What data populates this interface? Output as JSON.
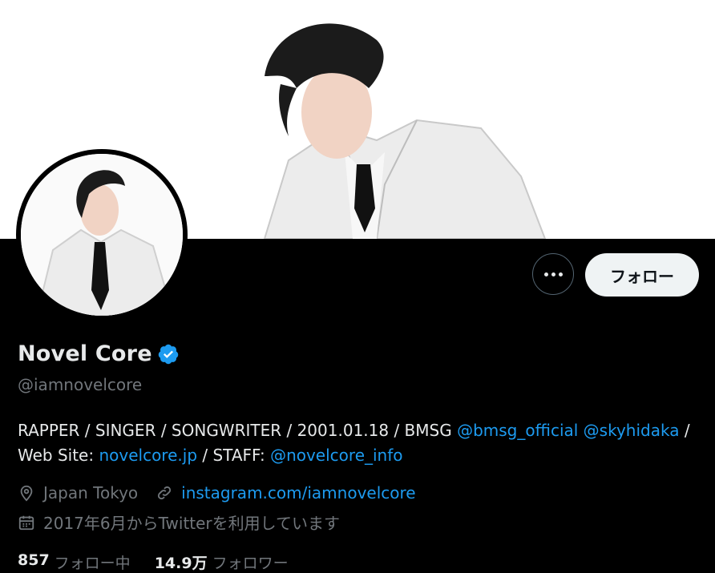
{
  "profile": {
    "name": "Novel Core",
    "handle": "@iamnovelcore",
    "verified": true,
    "bio": {
      "part1": "RAPPER / SINGER / SONGWRITER / 2001.01.18 / BMSG ",
      "mention1": "@bmsg_official",
      "space": " ",
      "mention2": "@skyhidaka",
      "part2": " / ",
      "part3": "Web Site: ",
      "site": "novelcore.jp",
      "part4": " / STAFF: ",
      "mention3": "@novelcore_info"
    },
    "location": "Japan Tokyo",
    "website": "instagram.com/iamnovelcore",
    "joined": "2017年6月からTwitterを利用しています"
  },
  "actions": {
    "follow_label": "フォロー"
  },
  "stats": {
    "following_count": "857",
    "following_label": "フォロー中",
    "followers_count": "14.9万",
    "followers_label": "フォロワー"
  },
  "colors": {
    "accent": "#1d9bf0",
    "background": "#000000",
    "muted": "#71767b"
  },
  "icons": [
    "more-icon",
    "verified-badge-icon",
    "location-icon",
    "link-icon",
    "calendar-icon"
  ]
}
